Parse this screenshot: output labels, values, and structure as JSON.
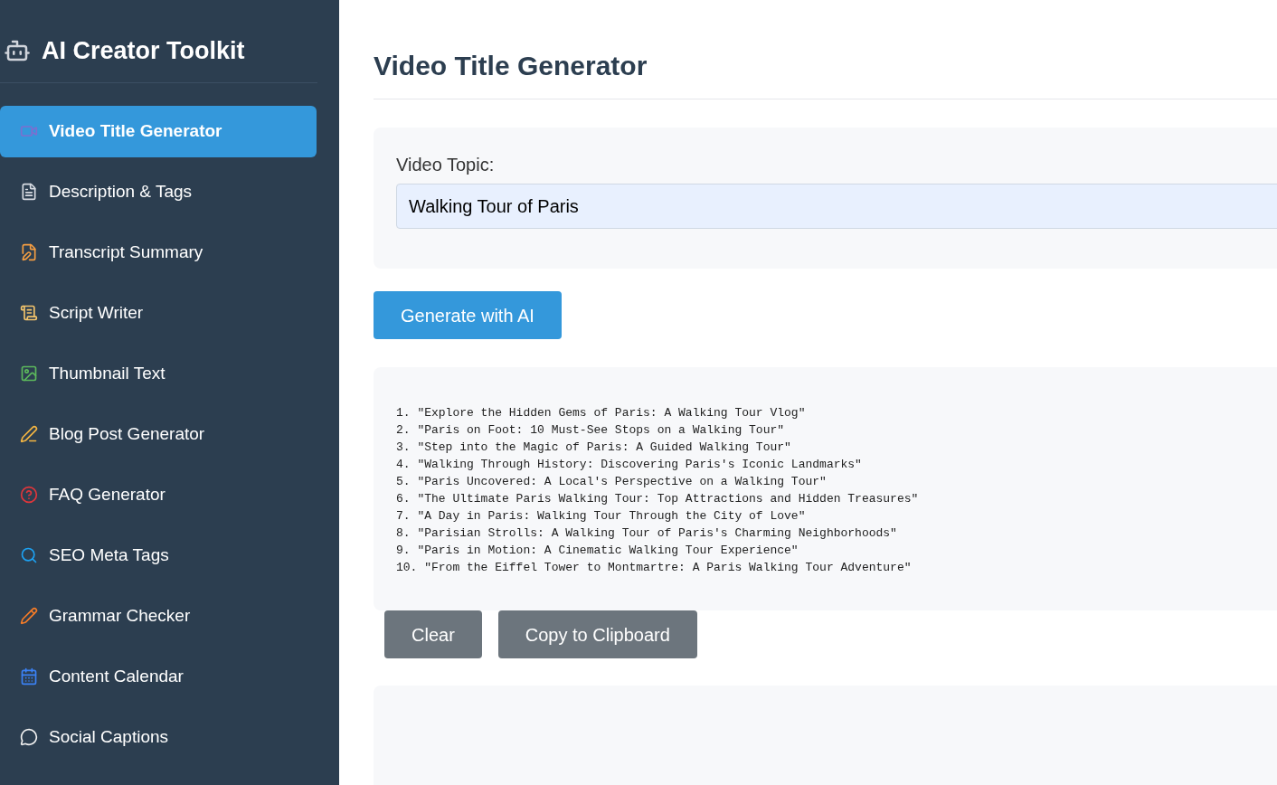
{
  "app": {
    "title": "AI Creator Toolkit"
  },
  "sidebar": {
    "items": [
      {
        "label": "Video Title Generator",
        "selected": true
      },
      {
        "label": "Description & Tags",
        "selected": false
      },
      {
        "label": "Transcript Summary",
        "selected": false
      },
      {
        "label": "Script Writer",
        "selected": false
      },
      {
        "label": "Thumbnail Text",
        "selected": false
      },
      {
        "label": "Blog Post Generator",
        "selected": false
      },
      {
        "label": "FAQ Generator",
        "selected": false
      },
      {
        "label": "SEO Meta Tags",
        "selected": false
      },
      {
        "label": "Grammar Checker",
        "selected": false
      },
      {
        "label": "Content Calendar",
        "selected": false
      },
      {
        "label": "Social Captions",
        "selected": false
      }
    ]
  },
  "main": {
    "heading": "Video Title Generator",
    "form": {
      "label": "Video Topic:",
      "value": "Walking Tour of Paris"
    },
    "generate_button": "Generate with AI",
    "output_lines": [
      "1. \"Explore the Hidden Gems of Paris: A Walking Tour Vlog\"",
      "2. \"Paris on Foot: 10 Must-See Stops on a Walking Tour\"",
      "3. \"Step into the Magic of Paris: A Guided Walking Tour\"",
      "4. \"Walking Through History: Discovering Paris's Iconic Landmarks\"",
      "5. \"Paris Uncovered: A Local's Perspective on a Walking Tour\"",
      "6. \"The Ultimate Paris Walking Tour: Top Attractions and Hidden Treasures\"",
      "7. \"A Day in Paris: Walking Tour Through the City of Love\"",
      "8. \"Parisian Strolls: A Walking Tour of Paris's Charming Neighborhoods\"",
      "9. \"Paris in Motion: A Cinematic Walking Tour Experience\"",
      "10. \"From the Eiffel Tower to Montmartre: A Paris Walking Tour Adventure\""
    ],
    "action_buttons": [
      "Clear",
      "Copy to Clipboard"
    ]
  }
}
